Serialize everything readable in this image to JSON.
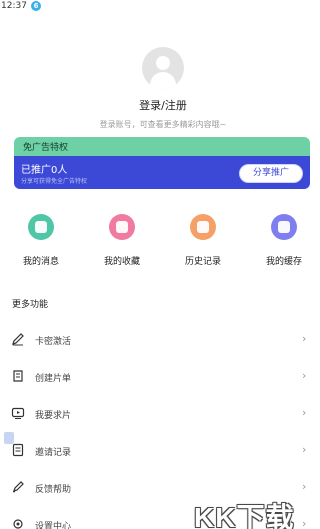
{
  "status_bar": {
    "time": "12:37",
    "app_badge": "6"
  },
  "profile": {
    "login_title": "登录/注册",
    "login_subtitle": "登录账号，可查看更多精彩内容哦~"
  },
  "ad_card": {
    "title": "免广告特权",
    "promoted_count": "已推广0人",
    "hint": "分享可获得免全广告特权",
    "share_button": "分享推广",
    "colors": {
      "top": "#6ed1a6",
      "bottom": "#3c49d6"
    }
  },
  "quick_actions": [
    {
      "label": "我的消息",
      "icon": "message-icon",
      "color": "#4fc7a7"
    },
    {
      "label": "我的收藏",
      "icon": "heart-icon",
      "color": "#f17aa0"
    },
    {
      "label": "历史记录",
      "icon": "history-icon",
      "color": "#f4a066"
    },
    {
      "label": "我的缓存",
      "icon": "cache-icon",
      "color": "#7f7ef0"
    }
  ],
  "more": {
    "title": "更多功能",
    "items": [
      {
        "label": "卡密激活",
        "icon": "pen-icon"
      },
      {
        "label": "创建片单",
        "icon": "playlist-icon"
      },
      {
        "label": "我要求片",
        "icon": "request-video-icon"
      },
      {
        "label": "邀请记录",
        "icon": "invite-record-icon"
      },
      {
        "label": "反馈帮助",
        "icon": "feedback-icon"
      },
      {
        "label": "设置中心",
        "icon": "settings-icon"
      }
    ]
  },
  "watermark": "KK下载"
}
